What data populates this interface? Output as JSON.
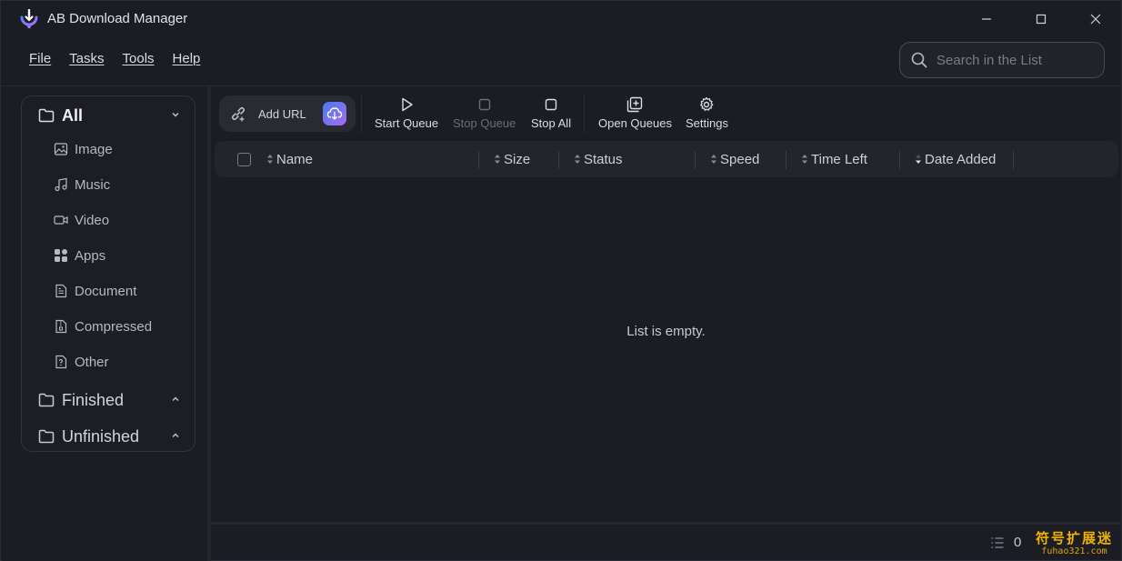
{
  "window": {
    "title": "AB Download Manager",
    "minimize_icon": "minimize-icon",
    "maximize_icon": "maximize-icon",
    "close_icon": "close-icon"
  },
  "menu": [
    "File",
    "Tasks",
    "Tools",
    "Help"
  ],
  "search": {
    "placeholder": "Search in the List",
    "icon": "search-icon"
  },
  "sidebar": {
    "all": {
      "label": "All",
      "expanded": true
    },
    "items": [
      {
        "label": "Image",
        "icon": "image-icon"
      },
      {
        "label": "Music",
        "icon": "music-icon"
      },
      {
        "label": "Video",
        "icon": "video-icon"
      },
      {
        "label": "Apps",
        "icon": "apps-icon"
      },
      {
        "label": "Document",
        "icon": "document-icon"
      },
      {
        "label": "Compressed",
        "icon": "compressed-icon"
      },
      {
        "label": "Other",
        "icon": "other-file-icon"
      }
    ],
    "finished": {
      "label": "Finished",
      "expanded": false
    },
    "unfinished": {
      "label": "Unfinished",
      "expanded": false
    }
  },
  "toolbar": {
    "add_url": "Add URL",
    "start_queue": "Start Queue",
    "stop_queue": "Stop Queue",
    "stop_all": "Stop All",
    "open_queues": "Open Queues",
    "settings": "Settings"
  },
  "table": {
    "columns": [
      "Name",
      "Size",
      "Status",
      "Speed",
      "Time Left",
      "Date Added"
    ],
    "sorted_column": "Date Added",
    "sort_direction": "descending",
    "empty_message": "List is empty."
  },
  "footer": {
    "count": "0"
  },
  "watermark": {
    "line1": "符号扩展迷",
    "line2": "fuhao321.com"
  },
  "colors": {
    "background": "#1c1c24",
    "accent_gradient_start": "#4b79f0",
    "accent_gradient_end": "#a46cf0",
    "watermark": "#f0b400"
  }
}
